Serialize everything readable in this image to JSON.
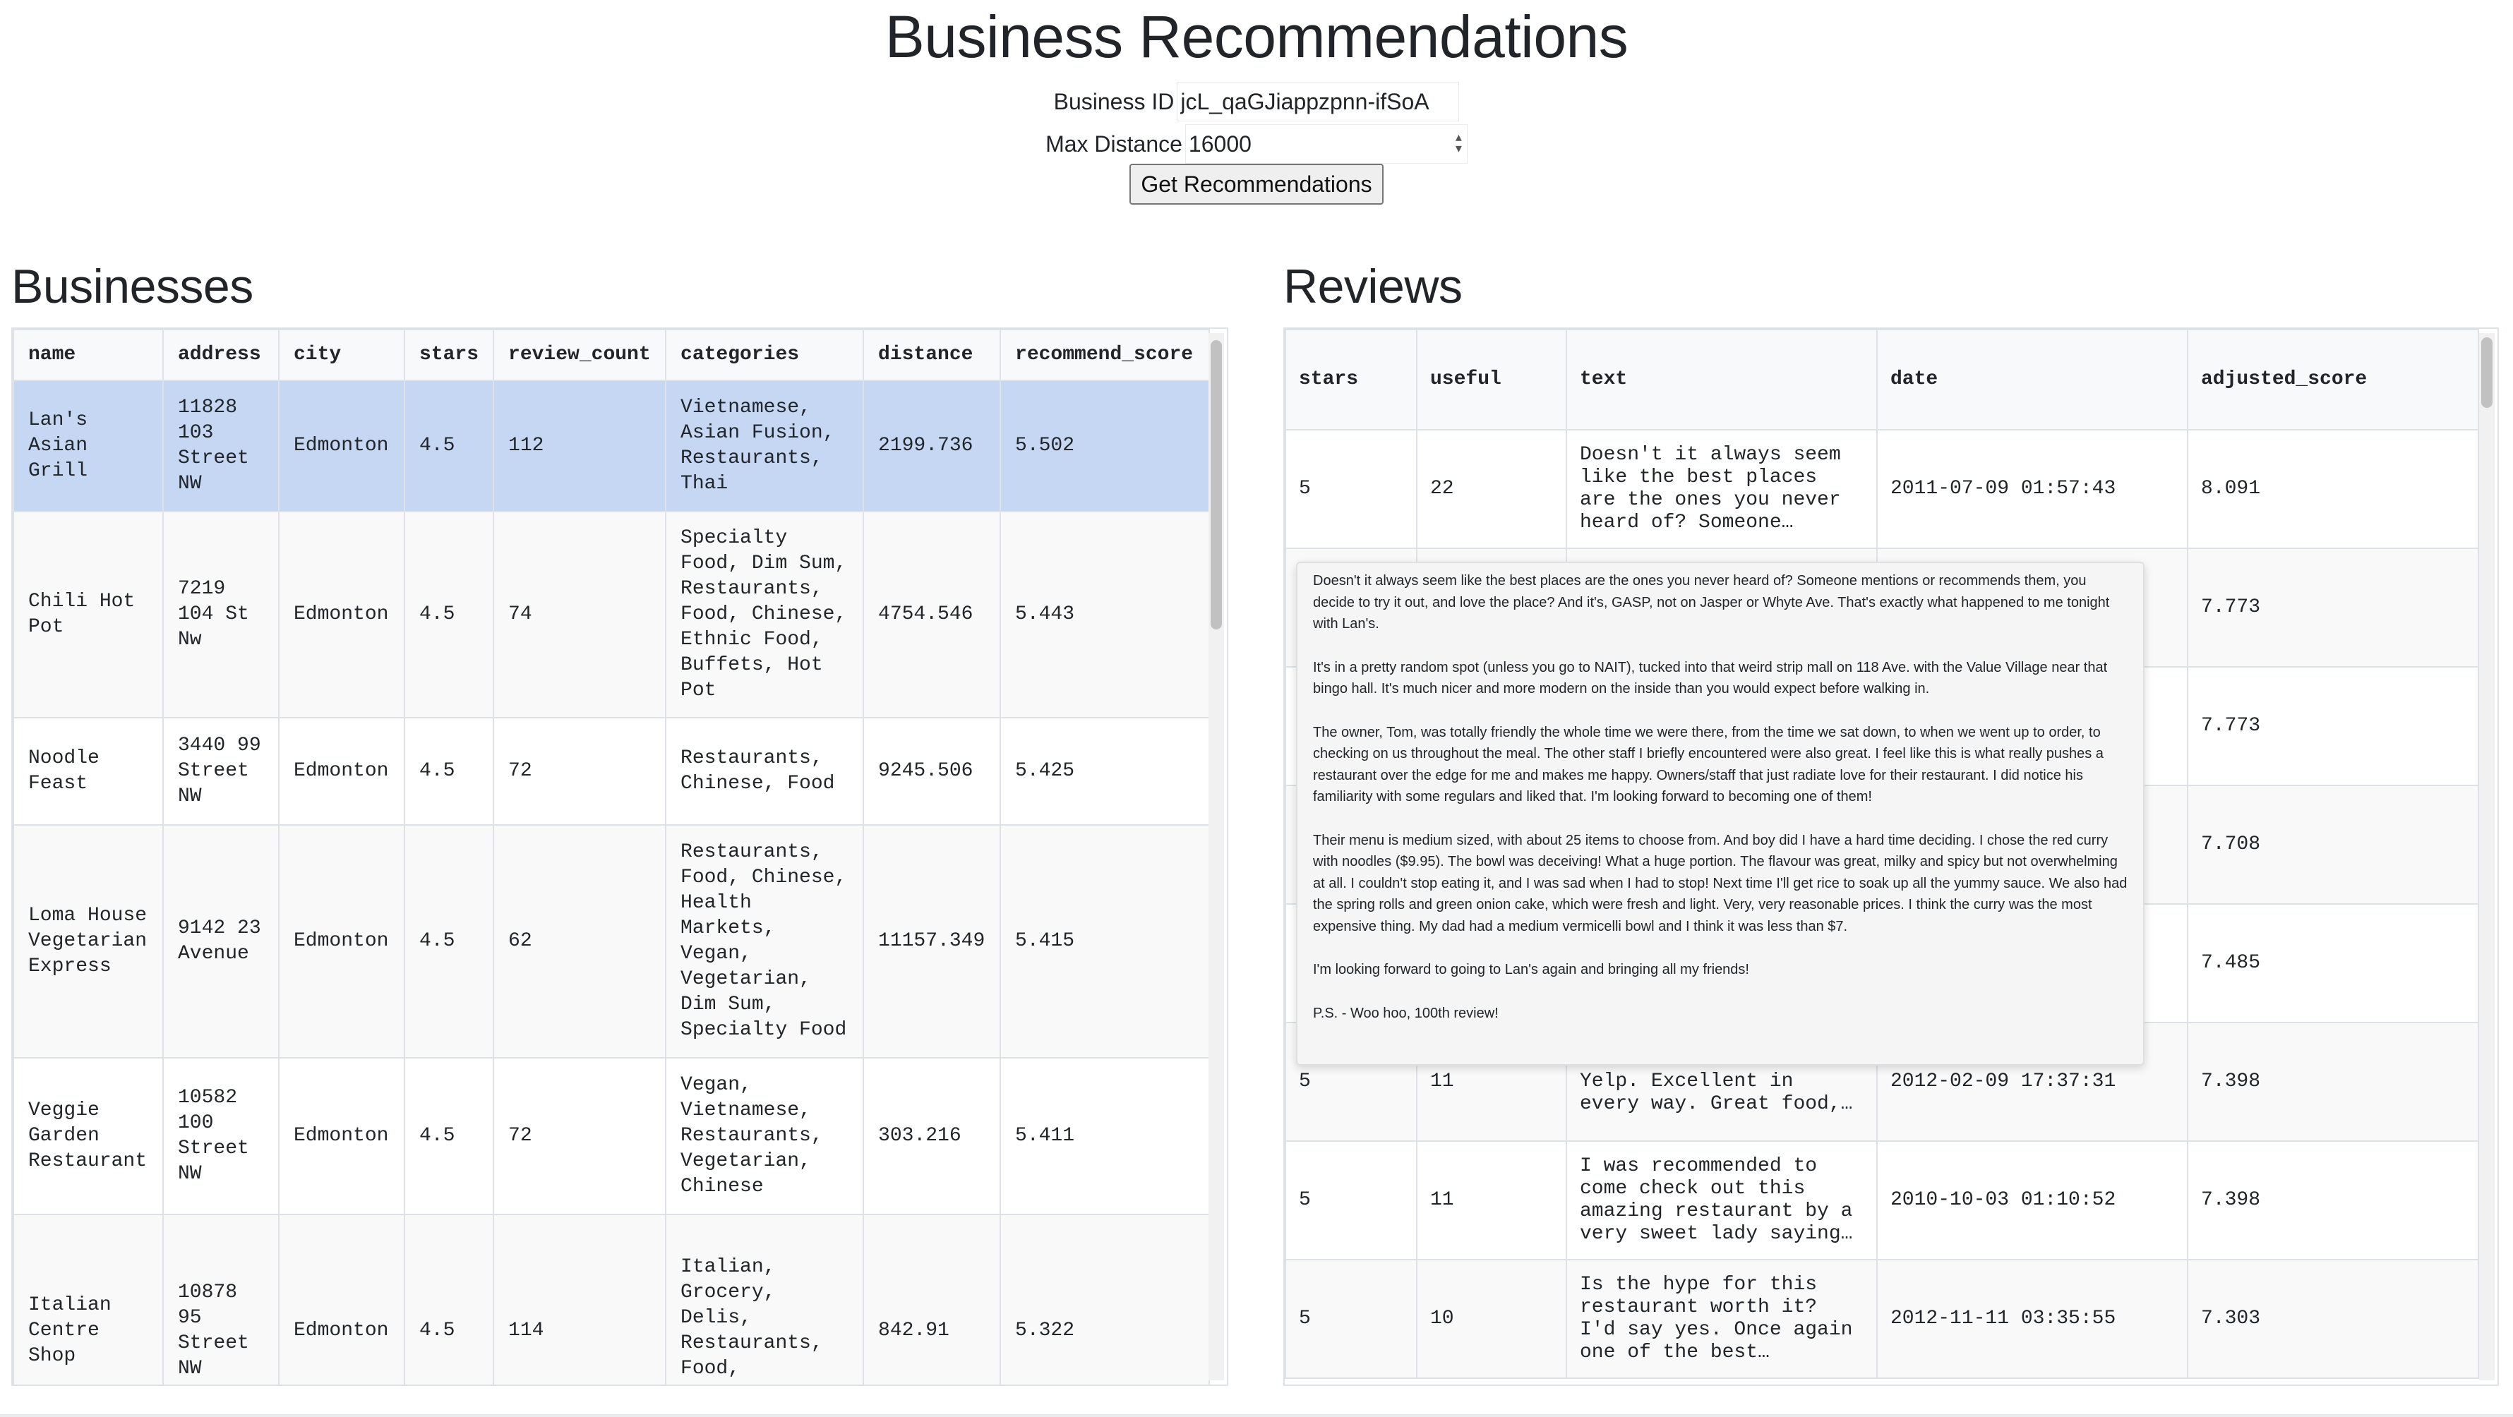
{
  "title": "Business Recommendations",
  "form": {
    "business_id_label": "Business ID",
    "business_id_value": "jcL_qaGJiappzpnn-ifSoA",
    "max_distance_label": "Max Distance",
    "max_distance_value": "16000",
    "submit_label": "Get Recommendations"
  },
  "businesses": {
    "title": "Businesses",
    "columns": [
      "name",
      "address",
      "city",
      "stars",
      "review_count",
      "categories",
      "distance",
      "recommend_score"
    ],
    "rows": [
      {
        "name": "Lan's Asian Grill",
        "address": "11828 103 Street NW",
        "city": "Edmonton",
        "stars": "4.5",
        "review_count": "112",
        "categories": "Vietnamese, Asian Fusion, Restaurants, Thai",
        "distance": "2199.736",
        "recommend_score": "5.502"
      },
      {
        "name": "Chili Hot Pot",
        "address": "7219 104 St Nw",
        "city": "Edmonton",
        "stars": "4.5",
        "review_count": "74",
        "categories": "Specialty Food, Dim Sum, Restaurants, Food, Chinese, Ethnic Food, Buffets, Hot Pot",
        "distance": "4754.546",
        "recommend_score": "5.443"
      },
      {
        "name": "Noodle Feast",
        "address": "3440 99 Street NW",
        "city": "Edmonton",
        "stars": "4.5",
        "review_count": "72",
        "categories": "Restaurants, Chinese, Food",
        "distance": "9245.506",
        "recommend_score": "5.425"
      },
      {
        "name": "Loma House Vegetarian Express",
        "address": "9142 23 Avenue",
        "city": "Edmonton",
        "stars": "4.5",
        "review_count": "62",
        "categories": "Restaurants, Food, Chinese, Health Markets, Vegan, Vegetarian, Dim Sum, Specialty Food",
        "distance": "11157.349",
        "recommend_score": "5.415"
      },
      {
        "name": "Veggie Garden Restaurant",
        "address": "10582 100 Street NW",
        "city": "Edmonton",
        "stars": "4.5",
        "review_count": "72",
        "categories": "Vegan, Vietnamese, Restaurants, Vegetarian, Chinese",
        "distance": "303.216",
        "recommend_score": "5.411"
      },
      {
        "name": "Italian Centre Shop",
        "address": "10878 95 Street NW",
        "city": "Edmonton",
        "stars": "4.5",
        "review_count": "114",
        "categories": "Italian, Grocery, Delis, Restaurants, Food, International",
        "distance": "842.91",
        "recommend_score": "5.322"
      }
    ]
  },
  "reviews": {
    "title": "Reviews",
    "columns": [
      "stars",
      "useful",
      "text",
      "date",
      "adjusted_score"
    ],
    "rows": [
      {
        "stars": "5",
        "useful": "22",
        "text": "Doesn't it always seem like the best places are the ones you never heard of? Someone…",
        "date": "2011-07-09 01:57:43",
        "adjusted_score": "8.091"
      },
      {
        "stars": "",
        "useful": "",
        "text": "",
        "date": "",
        "adjusted_score": "7.773"
      },
      {
        "stars": "",
        "useful": "",
        "text": "",
        "date": "",
        "adjusted_score": "7.773"
      },
      {
        "stars": "",
        "useful": "",
        "text": "",
        "date": "",
        "adjusted_score": "7.708"
      },
      {
        "stars": "",
        "useful": "",
        "text": "",
        "date": "",
        "adjusted_score": "7.485"
      },
      {
        "stars": "5",
        "useful": "11",
        "text": "all the reviews on Yelp. Excellent in every way. Great food,…",
        "date": "2012-02-09 17:37:31",
        "adjusted_score": "7.398"
      },
      {
        "stars": "5",
        "useful": "11",
        "text": "I was recommended to come check out this amazing restaurant by a very sweet lady saying…",
        "date": "2010-10-03 01:10:52",
        "adjusted_score": "7.398"
      },
      {
        "stars": "5",
        "useful": "10",
        "text": "Is the hype for this restaurant worth it? I'd say yes. Once again one of the best…",
        "date": "2012-11-11 03:35:55",
        "adjusted_score": "7.303"
      }
    ]
  },
  "tooltip": {
    "paragraphs": [
      "Doesn't it always seem like the best places are the ones you never heard of? Someone mentions or recommends them, you decide to try it out, and love the place? And it's, GASP, not on Jasper or Whyte Ave. That's exactly what happened to me tonight with Lan's.",
      "It's in a pretty random spot (unless you go to NAIT), tucked into that weird strip mall on 118 Ave. with the Value Village near that bingo hall. It's much nicer and more modern on the inside than you would expect before walking in.",
      "The owner, Tom, was totally friendly the whole time we were there, from the time we sat down, to when we went up to order, to checking on us throughout the meal. The other staff I briefly encountered were also great. I feel like this is what really pushes a restaurant over the edge for me and makes me happy. Owners/staff that just radiate love for their restaurant. I did notice his familiarity with some regulars and liked that. I'm looking forward to becoming one of them!",
      "Their menu is medium sized, with about 25 items to choose from. And boy did I have a hard time deciding. I chose the red curry with noodles ($9.95). The bowl was deceiving! What a huge portion. The flavour was great, milky and spicy but not overwhelming at all. I couldn't stop eating it, and I was sad when I had to stop! Next time I'll get rice to soak up all the yummy sauce. We also had the spring rolls and green onion cake, which were fresh and light. Very, very reasonable prices. I think the curry was the most expensive thing. My dad had a medium vermicelli bowl and I think it was less than $7.",
      "I'm looking forward to going to Lan's again and bringing all my friends!",
      "P.S. - Woo hoo, 100th review!"
    ]
  }
}
